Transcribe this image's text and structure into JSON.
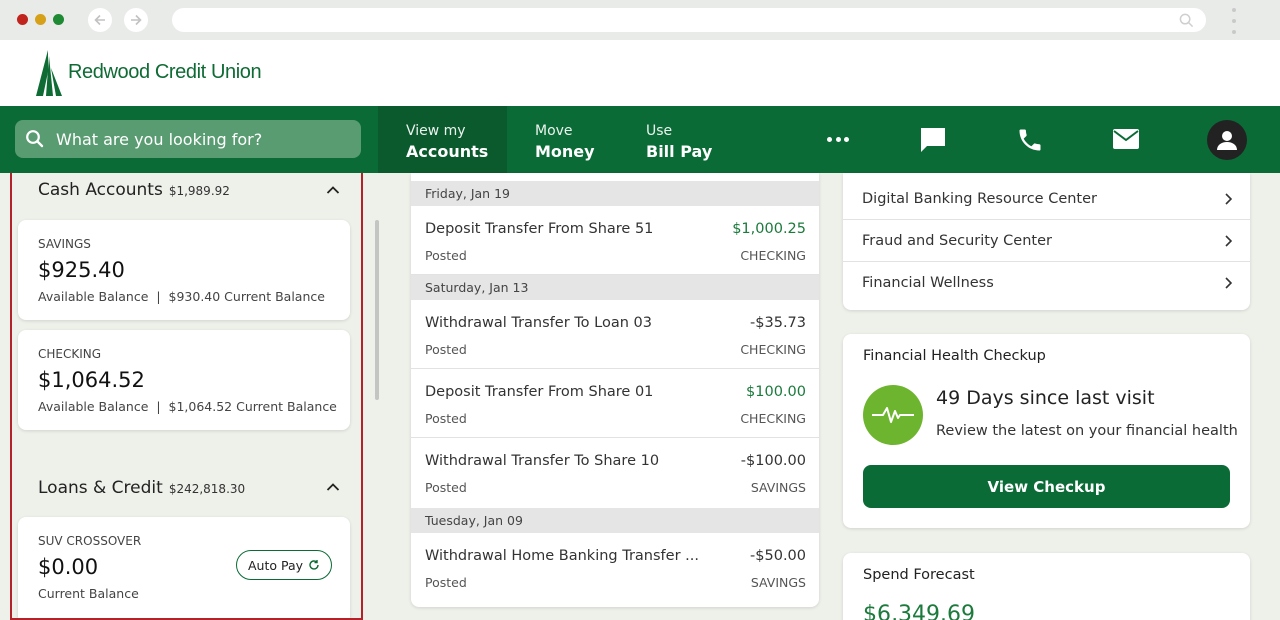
{
  "brand": {
    "name": "Redwood Credit Union"
  },
  "search": {
    "placeholder": "What are you looking for?"
  },
  "nav": {
    "items": [
      {
        "top": "View my",
        "bottom": "Accounts",
        "active": true
      },
      {
        "top": "Move",
        "bottom": "Money",
        "active": false
      },
      {
        "top": "Use",
        "bottom": "Bill Pay",
        "active": false
      }
    ],
    "icons": [
      "more-icon",
      "chat-icon",
      "phone-icon",
      "mail-icon",
      "user-icon"
    ]
  },
  "cash_accounts": {
    "title": "Cash Accounts",
    "total": "$1,989.92",
    "accounts": [
      {
        "label": "SAVINGS",
        "amount": "$925.40",
        "detail": "Available Balance  |  $930.40 Current Balance"
      },
      {
        "label": "CHECKING",
        "amount": "$1,064.52",
        "detail": "Available Balance  |  $1,064.52 Current Balance"
      }
    ]
  },
  "loans": {
    "title": "Loans & Credit",
    "total": "$242,818.30",
    "accounts": [
      {
        "label": "SUV CROSSOVER",
        "amount": "$0.00",
        "detail": "Current Balance",
        "button": "Auto Pay"
      }
    ]
  },
  "transactions": {
    "groups": [
      {
        "date": "Friday, Jan 19",
        "items": [
          {
            "desc": "Deposit Transfer From Share 51",
            "amount": "$1,000.25",
            "status": "Posted",
            "account": "CHECKING"
          }
        ]
      },
      {
        "date": "Saturday, Jan 13",
        "items": [
          {
            "desc": "Withdrawal Transfer To Loan 03",
            "amount": "-$35.73",
            "status": "Posted",
            "account": "CHECKING"
          },
          {
            "desc": "Deposit Transfer From Share 01",
            "amount": "$100.00",
            "status": "Posted",
            "account": "CHECKING"
          },
          {
            "desc": "Withdrawal Transfer To Share 10",
            "amount": "-$100.00",
            "status": "Posted",
            "account": "SAVINGS"
          }
        ]
      },
      {
        "date": "Tuesday, Jan 09",
        "items": [
          {
            "desc": "Withdrawal Home Banking Transfer ...",
            "amount": "-$50.00",
            "status": "Posted",
            "account": "SAVINGS"
          }
        ]
      }
    ]
  },
  "resources": {
    "links": [
      "Digital Banking Resource Center",
      "Fraud and Security Center",
      "Financial Wellness"
    ]
  },
  "health": {
    "title": "Financial Health Checkup",
    "days": "49 Days since last visit",
    "review": "Review the latest on your financial health",
    "button": "View Checkup"
  },
  "forecast": {
    "title": "Spend Forecast",
    "amount": "$6,349.69"
  },
  "colors": {
    "brand_green": "#0b6b36",
    "positive_green": "#1b7a3c",
    "health_green": "#6eb52f",
    "highlight_red": "#b22228"
  }
}
